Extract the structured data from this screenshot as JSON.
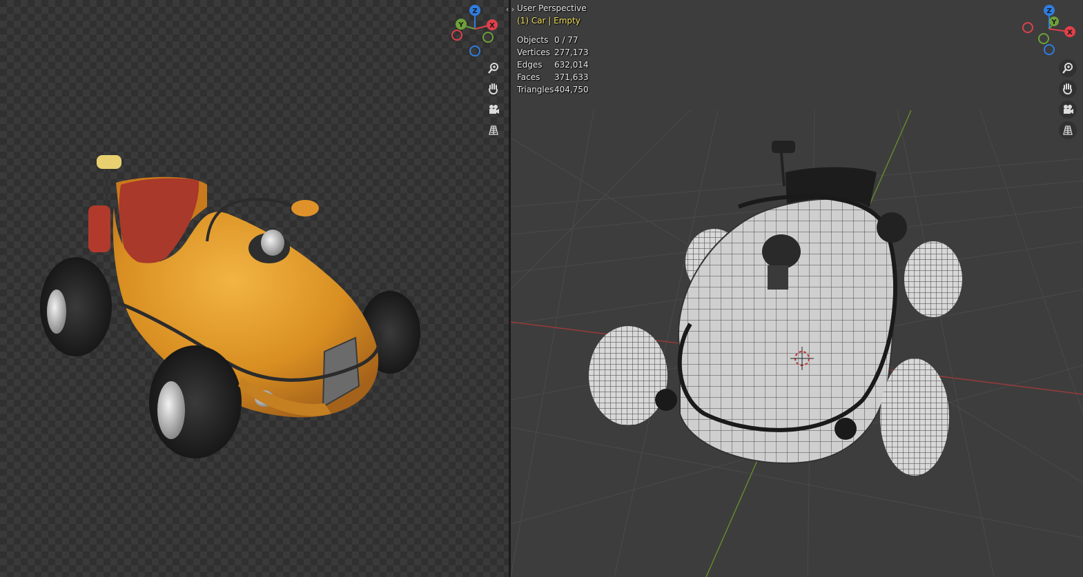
{
  "left_viewport": {
    "gizmo": {
      "labels": {
        "z": "Z",
        "y": "Y",
        "x": "X"
      }
    },
    "tools": [
      {
        "icon": "zoom-icon"
      },
      {
        "icon": "hand-icon"
      },
      {
        "icon": "camera-icon"
      },
      {
        "icon": "grid-icon"
      }
    ]
  },
  "right_viewport": {
    "view_name": "User Perspective",
    "object_info": "(1) Car | Empty",
    "stats": [
      {
        "label": "Objects",
        "value": "0 / 77"
      },
      {
        "label": "Vertices",
        "value": "277,173"
      },
      {
        "label": "Edges",
        "value": "632,014"
      },
      {
        "label": "Faces",
        "value": "371,633"
      },
      {
        "label": "Triangles",
        "value": "404,750"
      }
    ],
    "gizmo": {
      "labels": {
        "z": "Z",
        "y": "Y",
        "x": "X"
      }
    },
    "tools": [
      {
        "icon": "zoom-icon"
      },
      {
        "icon": "hand-icon"
      },
      {
        "icon": "camera-icon"
      },
      {
        "icon": "grid-icon"
      }
    ]
  },
  "split_handle_icon": "split-arrows-icon",
  "colors": {
    "axis_x": "#e0404a",
    "axis_y": "#6da13a",
    "axis_z": "#2f7de0",
    "car_body": "#e19a28",
    "seat_cushion": "#a9392a",
    "viewport_grid_bg": "#3d3d3d",
    "overlay_highlight": "#f0e060"
  }
}
